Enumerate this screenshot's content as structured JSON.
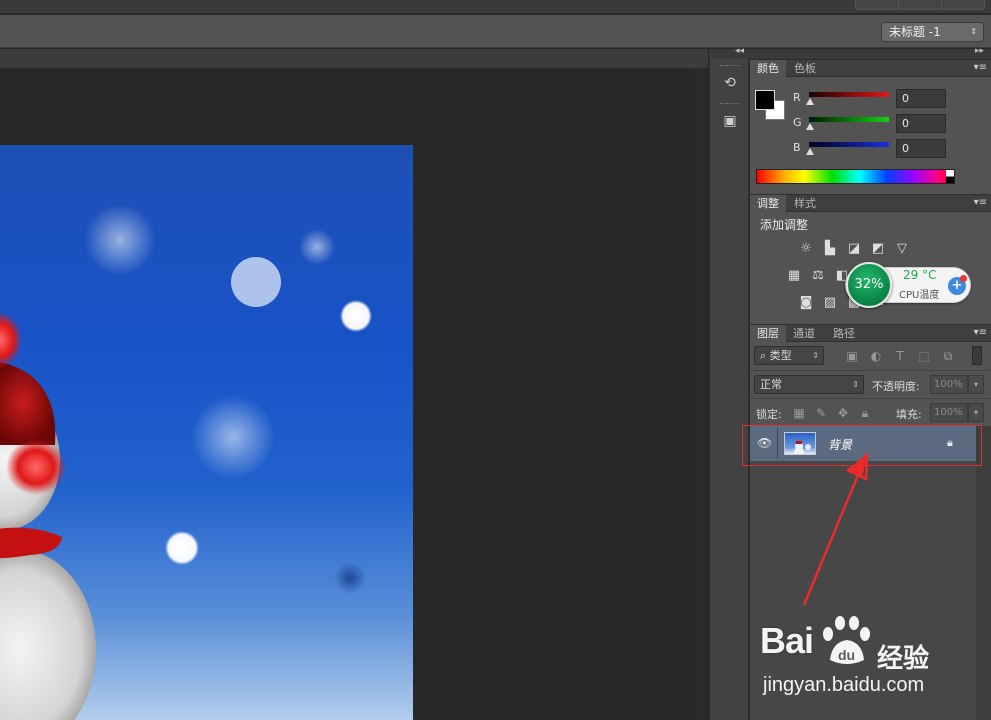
{
  "options_bar": {
    "document_selector": "未标题 -1"
  },
  "color_panel": {
    "tabs": [
      "颜色",
      "色板"
    ],
    "channels": [
      {
        "label": "R",
        "value": "0",
        "color": "#d01010"
      },
      {
        "label": "G",
        "value": "0",
        "color": "#10c010"
      },
      {
        "label": "B",
        "value": "0",
        "color": "#1020d0"
      }
    ]
  },
  "adjust_panel": {
    "tabs": [
      "调整",
      "样式"
    ],
    "heading": "添加调整"
  },
  "cpu_widget": {
    "percent": "32%",
    "temperature": "29 °C",
    "label": "CPU温度"
  },
  "layers_panel": {
    "tabs": [
      "图层",
      "通道",
      "路径"
    ],
    "filter_kind": "类型",
    "blend_mode": "正常",
    "opacity_label": "不透明度:",
    "opacity_value": "100%",
    "lock_label": "锁定:",
    "fill_label": "填充:",
    "fill_value": "100%",
    "layers": [
      {
        "name": "背景",
        "locked": true,
        "visible": true
      }
    ]
  },
  "watermark": {
    "brand": "Bai",
    "brand_suffix": "经验",
    "url": "jingyan.baidu.com"
  },
  "icons": {
    "history": "history-icon",
    "properties": "properties-icon",
    "eye": "eye-icon",
    "lock": "lock-icon"
  }
}
